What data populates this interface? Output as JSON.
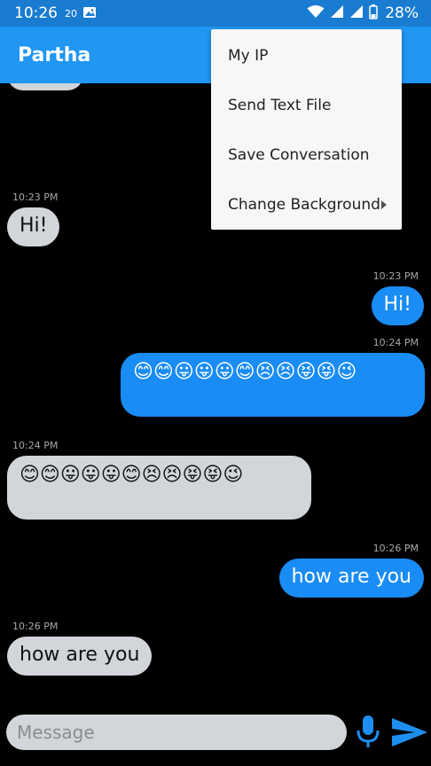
{
  "status_bar": {
    "time": "10:26",
    "small_count": "20",
    "battery": "28%"
  },
  "app_bar": {
    "title": "Partha"
  },
  "menu": {
    "items": [
      {
        "label": "My IP"
      },
      {
        "label": "Send Text File"
      },
      {
        "label": "Save Conversation"
      },
      {
        "label": "Change Background"
      }
    ]
  },
  "messages": [
    {
      "type": "incoming",
      "time": "10:23 PM",
      "text": "Hi!"
    },
    {
      "type": "outgoing",
      "time": "10:23 PM",
      "text": "Hi!"
    },
    {
      "type": "outgoing",
      "time": "10:24 PM",
      "text": "😊😊😛😛😛😊😣😣😝😝😉"
    },
    {
      "type": "incoming",
      "time": "10:24 PM",
      "text": "😊😊😛😛😛😊😣😣😝😝😉"
    },
    {
      "type": "outgoing",
      "time": "10:26 PM",
      "text": "how are you"
    },
    {
      "type": "incoming",
      "time": "10:26 PM",
      "text": "how are you"
    }
  ],
  "input": {
    "placeholder": "Message",
    "value": ""
  },
  "colors": {
    "status_bar": "#1A7CD1",
    "app_bar": "#2196F3",
    "outgoing_bubble": "#1A8CF5",
    "incoming_bubble": "#D2D5DA",
    "send_icon": "#1E8FF0",
    "chat_background": "#000000"
  },
  "icons": {
    "status": [
      "image-icon",
      "wifi-icon",
      "signal-icon",
      "signal-icon",
      "battery-icon"
    ],
    "input": [
      "microphone-icon",
      "send-icon"
    ]
  }
}
